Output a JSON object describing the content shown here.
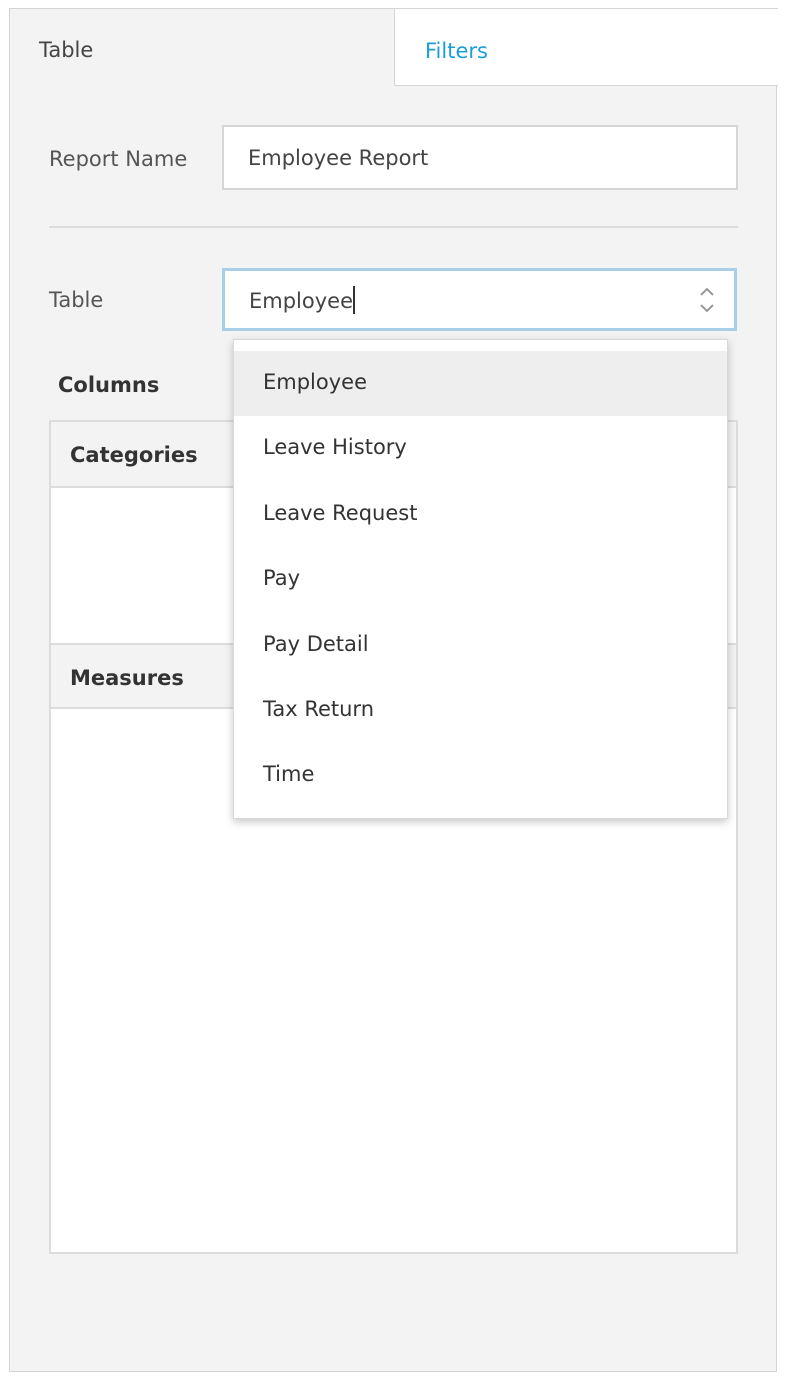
{
  "tabs": {
    "table_label": "Table",
    "filters_label": "Filters"
  },
  "form": {
    "report_name_label": "Report Name",
    "report_name_value": "Employee Report",
    "table_label": "Table",
    "table_value": "Employee"
  },
  "columns": {
    "title": "Columns",
    "categories_label": "Categories",
    "measures_label": "Measures"
  },
  "dropdown": {
    "options": [
      "Employee",
      "Leave History",
      "Leave Request",
      "Pay",
      "Pay Detail",
      "Tax Return",
      "Time"
    ],
    "highlighted": "Employee"
  },
  "colors": {
    "accent": "#1a9fda",
    "focus_border": "#a9cfe8",
    "panel_bg": "#f3f3f3"
  },
  "icons": {
    "select_arrows": "chevron-up-down-icon"
  }
}
